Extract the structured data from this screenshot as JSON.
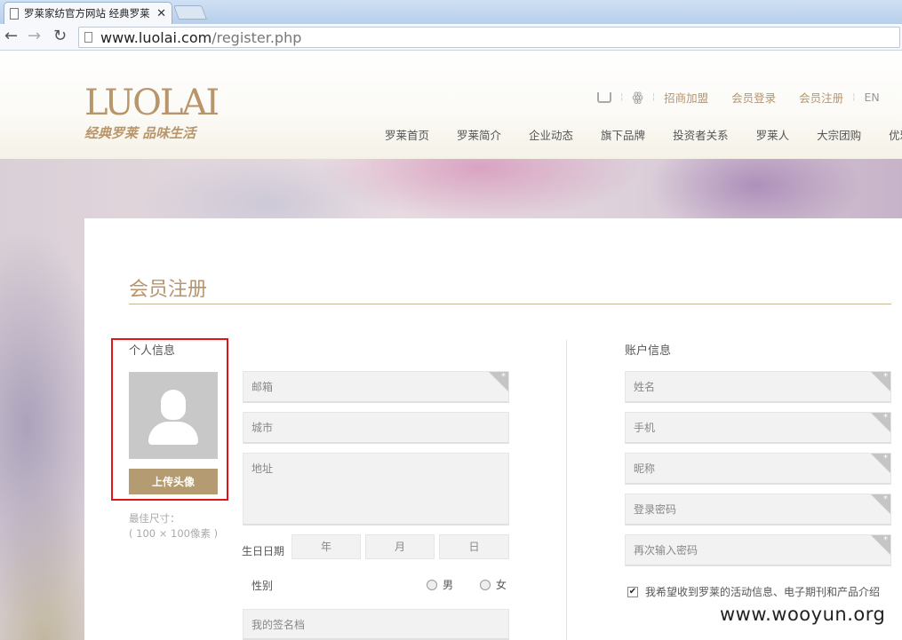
{
  "browser": {
    "tab_title": "罗莱家纺官方网站 经典罗莱",
    "tab_close": "✕",
    "back": "←",
    "forward": "→",
    "reload": "↻",
    "url_domain": "www.luolai.com",
    "url_path": "/register.php"
  },
  "header": {
    "logo_text": "LUOLAI",
    "slogan": "经典罗莱 品味生活",
    "weibo_glyph": "ꙮ",
    "top_links": [
      "招商加盟",
      "会员登录",
      "会员注册",
      "EN"
    ],
    "nav": [
      "罗莱首页",
      "罗莱简介",
      "企业动态",
      "旗下品牌",
      "投资者关系",
      "罗莱人",
      "大宗团购",
      "优雅"
    ]
  },
  "form": {
    "title": "会员注册",
    "personal_label": "个人信息",
    "account_label": "账户信息",
    "upload_label": "上传头像",
    "hint_line1": "最佳尺寸：",
    "hint_line2": "( 100 × 100像素 )",
    "email_placeholder": "邮箱",
    "city_placeholder": "城市",
    "address_placeholder": "地址",
    "dob_label": "生日日期",
    "year": "年",
    "month": "月",
    "day": "日",
    "gender_label": "性别",
    "male": "男",
    "female": "女",
    "signature_placeholder": "我的签名档",
    "name_placeholder": "姓名",
    "phone_placeholder": "手机",
    "nickname_placeholder": "昵称",
    "password_placeholder": "登录密码",
    "password2_placeholder": "再次输入密码",
    "consent_checked": "✔",
    "consent_text": "我希望收到罗莱的活动信息、电子期刊和产品介绍"
  },
  "watermark": "www.wooyun.org",
  "colors": {
    "accent": "#b8956a",
    "button": "#b59b72",
    "highlight": "#e0141a"
  }
}
